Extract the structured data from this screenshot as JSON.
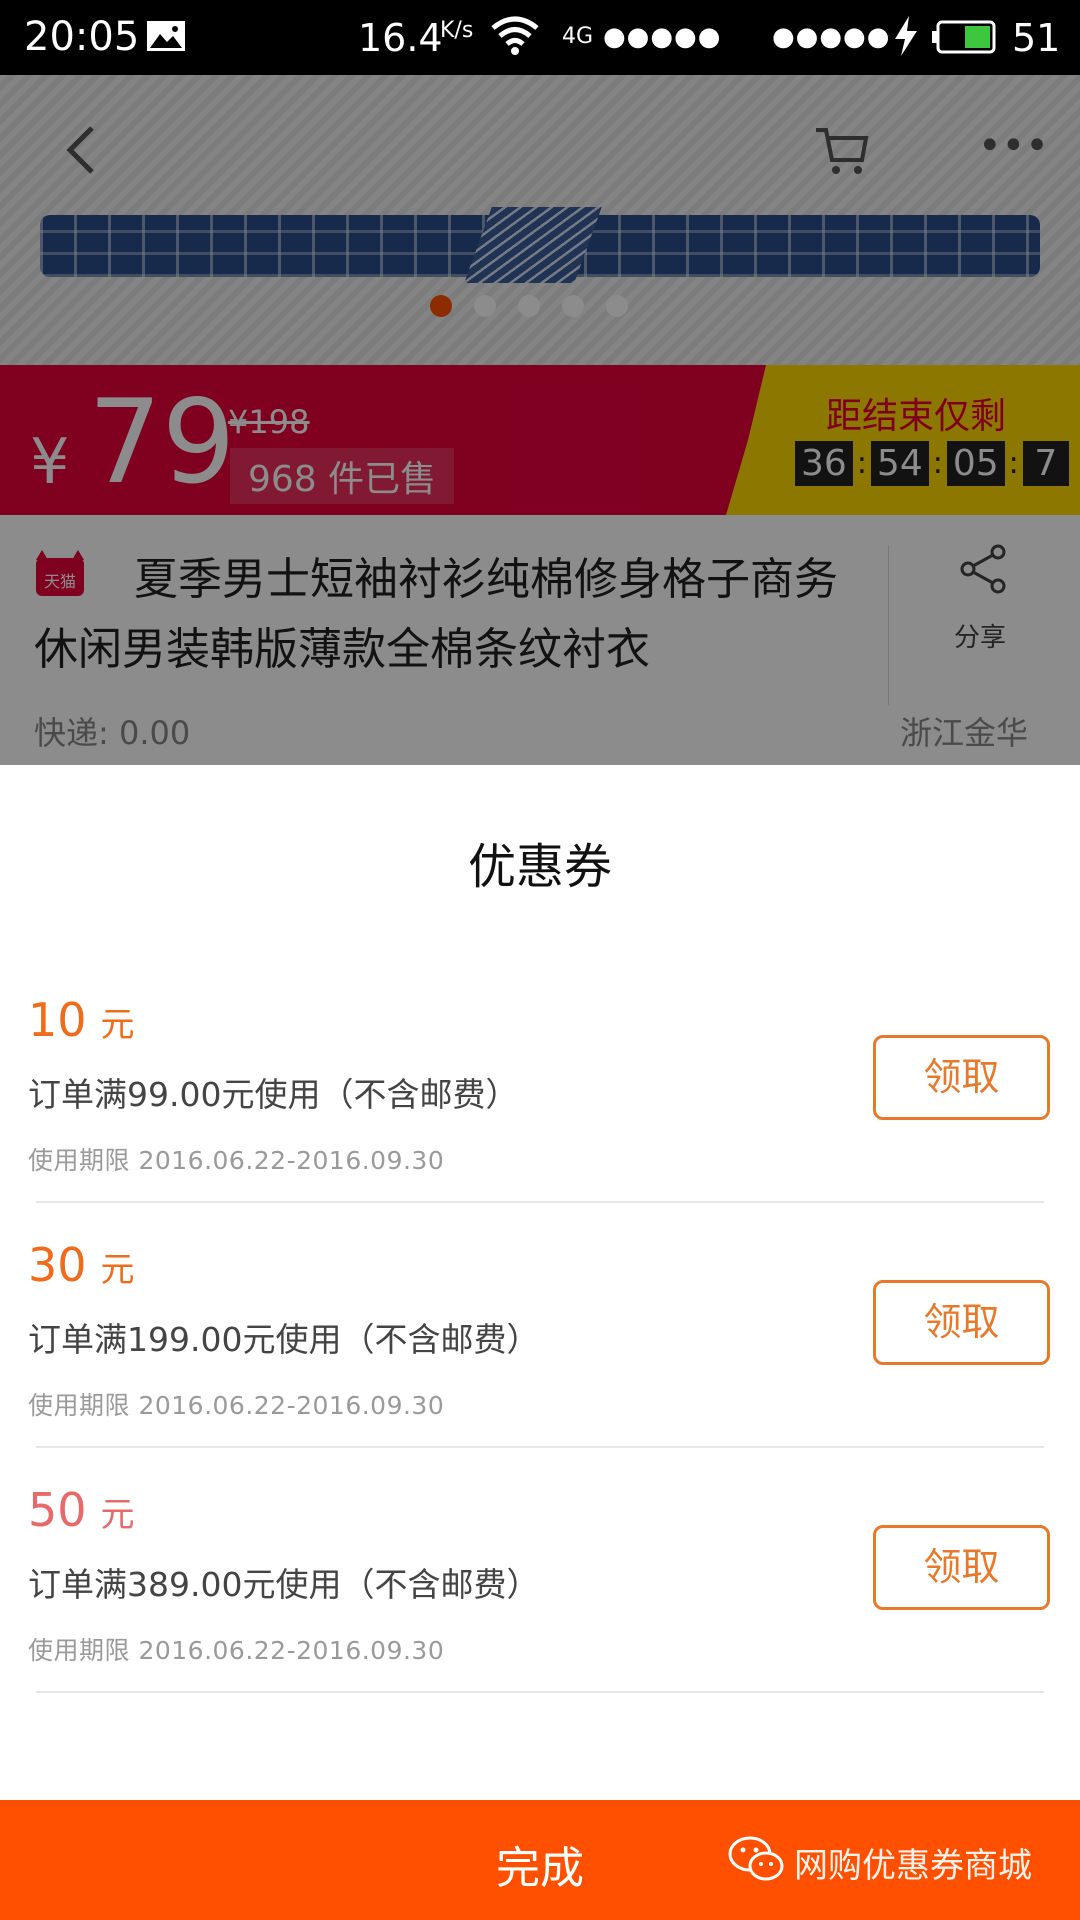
{
  "status_bar": {
    "time": "20:05",
    "speed": "16.4",
    "speed_unit": "K/s",
    "network": "4G",
    "signal1": "●●●●●",
    "signal2": "●●●●●",
    "battery": "51"
  },
  "product": {
    "currency": "¥",
    "price": "79",
    "original_price": "¥198",
    "sold": "968 件已售",
    "countdown_label": "距结束仅剩",
    "countdown": [
      "36",
      "54",
      "05",
      "7"
    ],
    "badge": "天猫",
    "title": "夏季男士短袖衬衫纯棉修身格子商务休闲男装韩版薄款全棉条纹衬衣",
    "share_label": "分享",
    "shipping": "快递: 0.00",
    "origin": "浙江金华",
    "accent_color": "#ff5000"
  },
  "coupon_sheet": {
    "title": "优惠券",
    "coupons": [
      {
        "amount": "10",
        "unit": "元",
        "condition": "订单满99.00元使用（不含邮费）",
        "period": "使用期限 2016.06.22-2016.09.30",
        "button": "领取"
      },
      {
        "amount": "30",
        "unit": "元",
        "condition": "订单满199.00元使用（不含邮费）",
        "period": "使用期限 2016.06.22-2016.09.30",
        "button": "领取"
      },
      {
        "amount": "50",
        "unit": "元",
        "condition": "订单满389.00元使用（不含邮费）",
        "period": "使用期限 2016.06.22-2016.09.30",
        "button": "领取"
      }
    ],
    "done_button": "完成",
    "watermark": "网购优惠券商城",
    "button_color": "#e8782a"
  }
}
